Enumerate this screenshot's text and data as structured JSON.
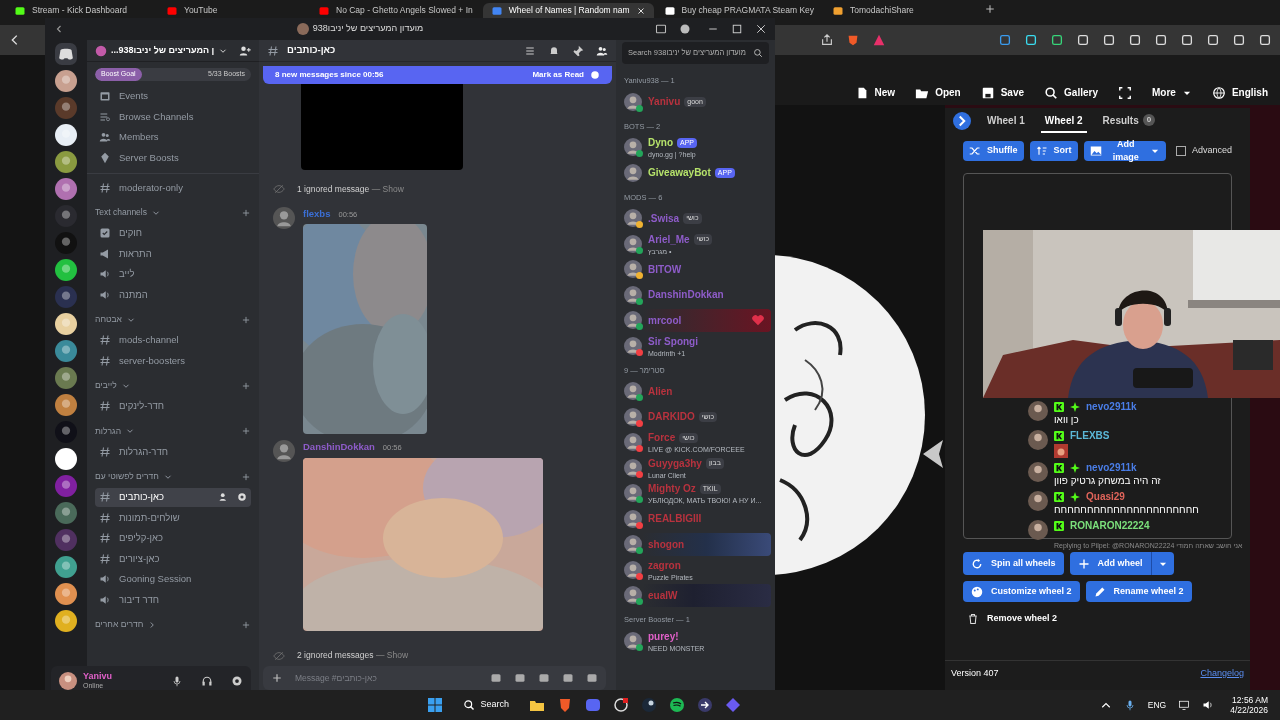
{
  "browser": {
    "tabs": [
      {
        "title": "Stream - Kick Dashboard",
        "selected": false
      },
      {
        "title": "YouTube",
        "selected": false
      },
      {
        "title": "No Cap - Ghetto Angels Slowed + In",
        "selected": false
      },
      {
        "title": "Wheel of Names | Random nam",
        "selected": true
      },
      {
        "title": "Buy cheap PRAGMATA Steam Key",
        "selected": false
      },
      {
        "title": "TomodachiShare",
        "selected": false
      }
    ]
  },
  "wheel_app": {
    "nav": [
      "New",
      "Open",
      "Save",
      "Gallery",
      "More",
      "English"
    ],
    "tabs": [
      {
        "label": "Wheel 1",
        "selected": false
      },
      {
        "label": "Wheel 2",
        "selected": true
      },
      {
        "label": "Results",
        "selected": false,
        "count": "0"
      }
    ],
    "tools": [
      "Shuffle",
      "Sort",
      "Add image"
    ],
    "advanced": {
      "label": "Advanced",
      "checked": false
    },
    "spin_button": "Spin all wheels",
    "add_button": "Add wheel",
    "customize_button": "Customize wheel 2",
    "rename_button": "Rename wheel 2",
    "remove_button": "Remove wheel 2",
    "version": "Version 407",
    "changelog": "Changelog"
  },
  "stream_chat": [
    {
      "user": "nevo2911k",
      "color": "#4a7ee8",
      "subscriber": true,
      "text": "כן וואו"
    },
    {
      "user": "FLEXBS",
      "color": "#5bb8d8",
      "subscriber": false,
      "emote": true
    },
    {
      "user": "nevo2911k",
      "color": "#4a7ee8",
      "subscriber": true,
      "text": "זה היה במשחק גרטיק פוון"
    },
    {
      "user": "Quasi29",
      "color": "#e0645a",
      "subscriber": true,
      "text": "חחחחחחחחחחחחחחחחחחחחחח"
    },
    {
      "user": "RONARON22224",
      "color": "#7be07b",
      "subscriber": false
    }
  ],
  "stream_reply": "Replying to Pilpel: @RONARON22224 אני חושב שאתה חמודי",
  "discord": {
    "window_title": "מועדון המעריצים של יניבו938",
    "server_name": "...ן המעריצים של יניבו938",
    "boost": {
      "label": "Boost Goal",
      "count": "5/33 Boosts",
      "level": 0.3
    },
    "menu": [
      {
        "kind": "events",
        "label": "Events"
      },
      {
        "kind": "browse",
        "label": "Browse Channels"
      },
      {
        "kind": "members",
        "label": "Members"
      },
      {
        "kind": "boosts",
        "label": "Server Boosts"
      }
    ],
    "channels": [
      {
        "kind": "text",
        "label": "moderator-only",
        "selected": false
      },
      {
        "kind": "category",
        "label": "Text channels",
        "expanded": true,
        "children": [
          {
            "kind": "rules",
            "label": "חוקים",
            "selected": false
          },
          {
            "kind": "announce",
            "label": "התראות",
            "selected": false
          },
          {
            "kind": "voice",
            "label": "לייב",
            "selected": false
          },
          {
            "kind": "voice",
            "label": "המתנה",
            "selected": false
          }
        ]
      },
      {
        "kind": "category",
        "label": "אבטחה",
        "expanded": true,
        "children": [
          {
            "kind": "text",
            "label": "mods-channel",
            "selected": false
          },
          {
            "kind": "text",
            "label": "server-boosters",
            "selected": false
          }
        ]
      },
      {
        "kind": "category",
        "label": "לייבים",
        "expanded": true,
        "children": [
          {
            "kind": "text",
            "label": "חדר-לינקים",
            "selected": false
          }
        ]
      },
      {
        "kind": "category",
        "label": "הגרלות",
        "expanded": true,
        "children": [
          {
            "kind": "text",
            "label": "חדר-הגרלות",
            "selected": false
          }
        ]
      },
      {
        "kind": "category",
        "label": "חדרים לפשוטי עם",
        "expanded": true,
        "children": [
          {
            "kind": "text",
            "label": "כאן-כותבים",
            "selected": true
          },
          {
            "kind": "text",
            "label": "שולחים-תמונות",
            "selected": false
          },
          {
            "kind": "text",
            "label": "כאן-קליפים",
            "selected": false
          },
          {
            "kind": "text",
            "label": "כאן-ציורים",
            "selected": false
          },
          {
            "kind": "voice",
            "label": "Gooning Session",
            "selected": false
          },
          {
            "kind": "voice",
            "label": "חדר דיבור",
            "selected": false
          }
        ]
      },
      {
        "kind": "category",
        "label": "חדרים אחרים",
        "expanded": false
      }
    ],
    "user": {
      "name": "Yanivu",
      "status_text": "Online"
    },
    "channel_title": "כאן-כותבים",
    "new_messages": {
      "text": "8 new messages since 00:56",
      "action": "Mark as Read"
    },
    "messages": [
      {
        "kind": "attachment"
      },
      {
        "kind": "ignored",
        "text": "1 ignored message",
        "action": "— Show"
      },
      {
        "kind": "message",
        "author": "flexbs",
        "color": "#3b6fd6",
        "time": "00:56"
      },
      {
        "kind": "message",
        "author": "DanshinDokkan",
        "color": "#8e5cc9",
        "time": "00:56"
      },
      {
        "kind": "ignored",
        "text": "2 ignored messages",
        "action": "— Show"
      }
    ],
    "composer": {
      "placeholder": "Message #כאן-כותבים"
    },
    "member_search": {
      "placeholder": "Search מועדון המעריצים של יניבו938"
    },
    "member_groups": [
      {
        "title": "Yanivu938 — 1",
        "members": [
          {
            "name": "Yanivu",
            "color": "#b8323e",
            "status_dot": {
              "color": "#23a55a"
            },
            "tag": {
              "kind": "role",
              "label": "goon"
            }
          }
        ]
      },
      {
        "title": "BOTS — 2",
        "members": [
          {
            "name": "Dyno",
            "color": "#b6e36b",
            "status_dot": {
              "color": "#23a55a"
            },
            "tag": {
              "kind": "app",
              "label": "APP"
            },
            "activity": "dyno.gg | ?help"
          },
          {
            "name": "GiveawayBot",
            "color": "#b6e36b",
            "tag": {
              "kind": "app",
              "label": "APP"
            }
          }
        ]
      },
      {
        "title": "MODS — 6",
        "members": [
          {
            "name": ".Swisa",
            "color": "#8e5cc9",
            "status_dot": {
              "color": "#f0b232"
            },
            "tag": {
              "kind": "role",
              "label": "כושי"
            }
          },
          {
            "name": "Ariel_Me",
            "color": "#8e5cc9",
            "status_dot": {
              "color": "#23a55a"
            },
            "tag": {
              "kind": "role",
              "label": "כושי"
            },
            "activity": "מגרבץ •"
          },
          {
            "name": "BITOW",
            "color": "#8e5cc9",
            "status_dot": {
              "color": "#f0b232"
            }
          },
          {
            "name": "DanshinDokkan",
            "color": "#8e5cc9",
            "status_dot": {
              "color": "#23a55a"
            }
          },
          {
            "name": "mrcool",
            "color": "#8e5cc9",
            "status_dot": {
              "color": "#23a55a"
            },
            "nameplate": {
              "kind": "heart"
            }
          },
          {
            "name": "Sir Spongi",
            "color": "#8e5cc9",
            "status_dot": {
              "color": "#f23f43"
            },
            "activity": "Modrinth +1"
          }
        ]
      },
      {
        "title": "סטרימר — 9",
        "members": [
          {
            "name": "Alien",
            "color": "#b8323e",
            "status_dot": {
              "color": "#23a55a"
            }
          },
          {
            "name": "DARKIDO",
            "color": "#b8323e",
            "status_dot": {
              "color": "#f23f43"
            },
            "tag": {
              "kind": "role",
              "label": "כושי"
            }
          },
          {
            "name": "Force",
            "color": "#b8323e",
            "status_dot": {
              "color": "#f23f43"
            },
            "tag": {
              "kind": "role",
              "label": "כושי"
            },
            "activity": "LIVE @ KICK.COM/FORCEEE"
          },
          {
            "name": "Guyyga3hy",
            "color": "#b8323e",
            "status_dot": {
              "color": "#f23f43"
            },
            "tag": {
              "kind": "role",
              "label": "בבון"
            },
            "activity": "Lunar Client"
          },
          {
            "name": "Mighty Oz",
            "color": "#b8323e",
            "status_dot": {
              "color": "#23a55a"
            },
            "tag": {
              "kind": "role",
              "label": "TKIL"
            },
            "activity": "УБЛЮДОК, МАТЬ ТВОЮ! А НУ И..."
          },
          {
            "name": "REALBIGIII",
            "color": "#b8323e",
            "status_dot": {
              "color": "#f23f43"
            }
          },
          {
            "name": "shogon",
            "color": "#b8323e",
            "status_dot": {
              "color": "#23a55a"
            },
            "nameplate": {
              "kind": "space"
            }
          },
          {
            "name": "zagron",
            "color": "#b8323e",
            "status_dot": {
              "color": "#f23f43"
            },
            "activity": "Puzzle Pirates"
          },
          {
            "name": "eualW",
            "color": "#b8323e",
            "status_dot": {
              "color": "#23a55a"
            },
            "nameplate": {
              "kind": "night"
            }
          }
        ]
      },
      {
        "title": "Server Booster — 1",
        "members": [
          {
            "name": "purey!",
            "color": "#e060c8",
            "status_dot": {
              "color": "#23a55a"
            },
            "activity": "NEED MONSTER"
          }
        ]
      }
    ]
  },
  "taskbar": {
    "search": "Search",
    "language": "ENG",
    "time": "12:56 AM",
    "date": "4/22/2026"
  }
}
